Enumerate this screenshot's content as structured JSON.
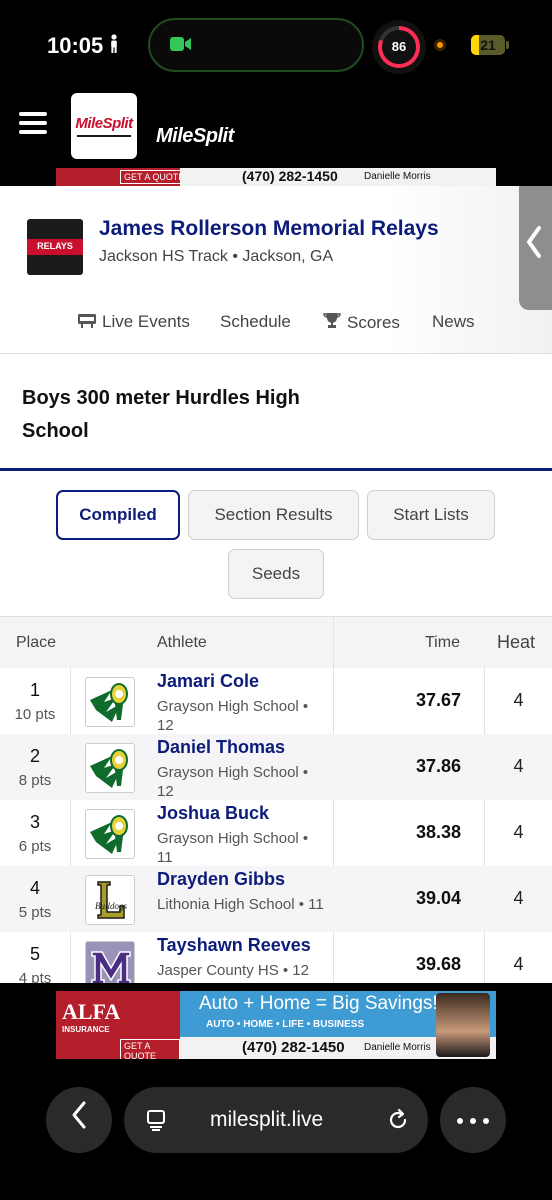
{
  "status_bar": {
    "time": "10:05",
    "activity_ring_value": "86",
    "battery_level": "21"
  },
  "app_header": {
    "logo_text": "MileSplit",
    "brand_text": "MileSplit"
  },
  "ad": {
    "brand": "ALFA",
    "insurance_label": "INSURANCE",
    "quote_label": "GET A QUOTE",
    "headline": "Auto + Home = Big Savings!",
    "sub": "AUTO • HOME • LIFE • BUSINESS",
    "phone": "(470) 282-1450",
    "agent": "Danielle Morris"
  },
  "meet": {
    "title": "James Rollerson Memorial Relays",
    "location": "Jackson HS Track • Jackson, GA",
    "logo_text": "RELAYS"
  },
  "nav": {
    "live_events": "Live Events",
    "schedule": "Schedule",
    "scores": "Scores",
    "news": "News"
  },
  "event": {
    "title": "Boys 300 meter Hurdles High School"
  },
  "tabs": {
    "compiled": "Compiled",
    "section_results": "Section Results",
    "start_lists": "Start Lists",
    "seeds": "Seeds"
  },
  "table": {
    "headers": {
      "place": "Place",
      "athlete": "Athlete",
      "time": "Time",
      "heat": "Heat"
    },
    "rows": [
      {
        "place": "1",
        "points": "10 pts",
        "name": "Jamari Cole",
        "school": "Grayson High School • 12",
        "time": "37.67",
        "heat": "4",
        "logo": "grayson-ram"
      },
      {
        "place": "2",
        "points": "8 pts",
        "name": "Daniel Thomas",
        "school": "Grayson High School • 12",
        "time": "37.86",
        "heat": "4",
        "logo": "grayson-ram"
      },
      {
        "place": "3",
        "points": "6 pts",
        "name": "Joshua Buck",
        "school": "Grayson High School • 11",
        "time": "38.38",
        "heat": "4",
        "logo": "grayson-ram"
      },
      {
        "place": "4",
        "points": "5 pts",
        "name": "Drayden Gibbs",
        "school": "Lithonia High School • 11",
        "time": "39.04",
        "heat": "4",
        "logo": "lithonia-l"
      },
      {
        "place": "5",
        "points": "4 pts",
        "name": "Tayshawn Reeves",
        "school": "Jasper County HS • 12",
        "time": "39.68",
        "heat": "4",
        "logo": "jasper-m"
      }
    ]
  },
  "browser": {
    "url": "milesplit.live"
  },
  "colors": {
    "brand_navy": "#0d1c7a",
    "brand_red": "#c8102e"
  }
}
